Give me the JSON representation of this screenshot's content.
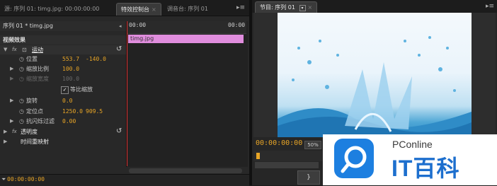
{
  "left_panel": {
    "tabs": [
      {
        "label": "源: 序列 01: timg.jpg: 00:00:00:00",
        "active": false
      },
      {
        "label": "特效控制台",
        "active": true
      },
      {
        "label": "调音台: 序列 01",
        "active": false
      }
    ],
    "sequence_label": "序列 01 * timg.jpg",
    "ruler_time": "00:00",
    "ruler_time_right": "00:00",
    "section": "视频效果",
    "clip_label": "timg.jpg",
    "motion": {
      "name": "运动",
      "position": {
        "label": "位置",
        "x": "553.7",
        "y": "-140.0"
      },
      "scale": {
        "label": "缩放比例",
        "value": "100.0"
      },
      "scale_width": {
        "label": "缩放宽度",
        "value": "100.0"
      },
      "uniform_scale": {
        "label": "等比缩放",
        "checked": true
      },
      "rotation": {
        "label": "旋转",
        "value": "0.0"
      },
      "anchor": {
        "label": "定位点",
        "x": "1250.0",
        "y": "909.5"
      },
      "antiflicker": {
        "label": "抗闪烁过滤",
        "value": "0.00"
      }
    },
    "opacity": {
      "name": "透明度"
    },
    "time_remap": {
      "name": "时间重映射"
    },
    "bottom_timecode": "00:00:00:00"
  },
  "right_panel": {
    "tab": "节目: 序列 01",
    "timecode": "00:00:00:00",
    "zoom": "50%",
    "control_button": "}"
  },
  "watermark": {
    "sub": "PConline",
    "main": "IT百科"
  },
  "colors": {
    "timecode": "#e8a526",
    "clip": "#e08ddd",
    "playhead": "#dd3333",
    "brand_blue": "#1d7fe0"
  }
}
